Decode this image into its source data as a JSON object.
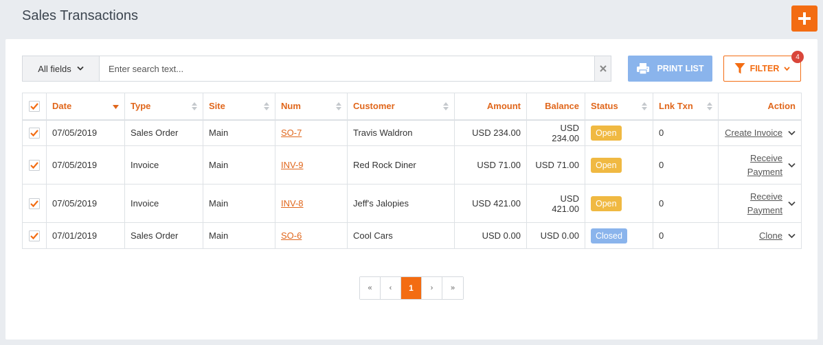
{
  "header": {
    "title": "Sales Transactions",
    "add_icon": "plus-icon"
  },
  "colors": {
    "accent": "#f36c12",
    "open": "#f0b942",
    "closed": "#8ab4ec",
    "badge": "#d9463a"
  },
  "search": {
    "field_select": "All fields",
    "placeholder": "Enter search text..."
  },
  "toolbar": {
    "print_label": "PRINT LIST",
    "filter_label": "FILTER",
    "filter_count": "4"
  },
  "table": {
    "columns": [
      "Date",
      "Type",
      "Site",
      "Num",
      "Customer",
      "Amount",
      "Balance",
      "Status",
      "Lnk Txn",
      "Action"
    ],
    "rows": [
      {
        "date": "07/05/2019",
        "type": "Sales Order",
        "site": "Main",
        "num": "SO-7",
        "customer": "Travis Waldron",
        "amount": "USD 234.00",
        "balance": "USD 234.00",
        "status": "Open",
        "lnk": "0",
        "action": "Create Invoice"
      },
      {
        "date": "07/05/2019",
        "type": "Invoice",
        "site": "Main",
        "num": "INV-9",
        "customer": "Red Rock Diner",
        "amount": "USD 71.00",
        "balance": "USD 71.00",
        "status": "Open",
        "lnk": "0",
        "action": "Receive Payment"
      },
      {
        "date": "07/05/2019",
        "type": "Invoice",
        "site": "Main",
        "num": "INV-8",
        "customer": "Jeff's Jalopies",
        "amount": "USD 421.00",
        "balance": "USD 421.00",
        "status": "Open",
        "lnk": "0",
        "action": "Receive Payment"
      },
      {
        "date": "07/01/2019",
        "type": "Sales Order",
        "site": "Main",
        "num": "SO-6",
        "customer": "Cool Cars",
        "amount": "USD 0.00",
        "balance": "USD 0.00",
        "status": "Closed",
        "lnk": "0",
        "action": "Clone"
      }
    ]
  },
  "pagination": {
    "first": "«",
    "prev": "‹",
    "current": "1",
    "next": "›",
    "last": "»"
  }
}
